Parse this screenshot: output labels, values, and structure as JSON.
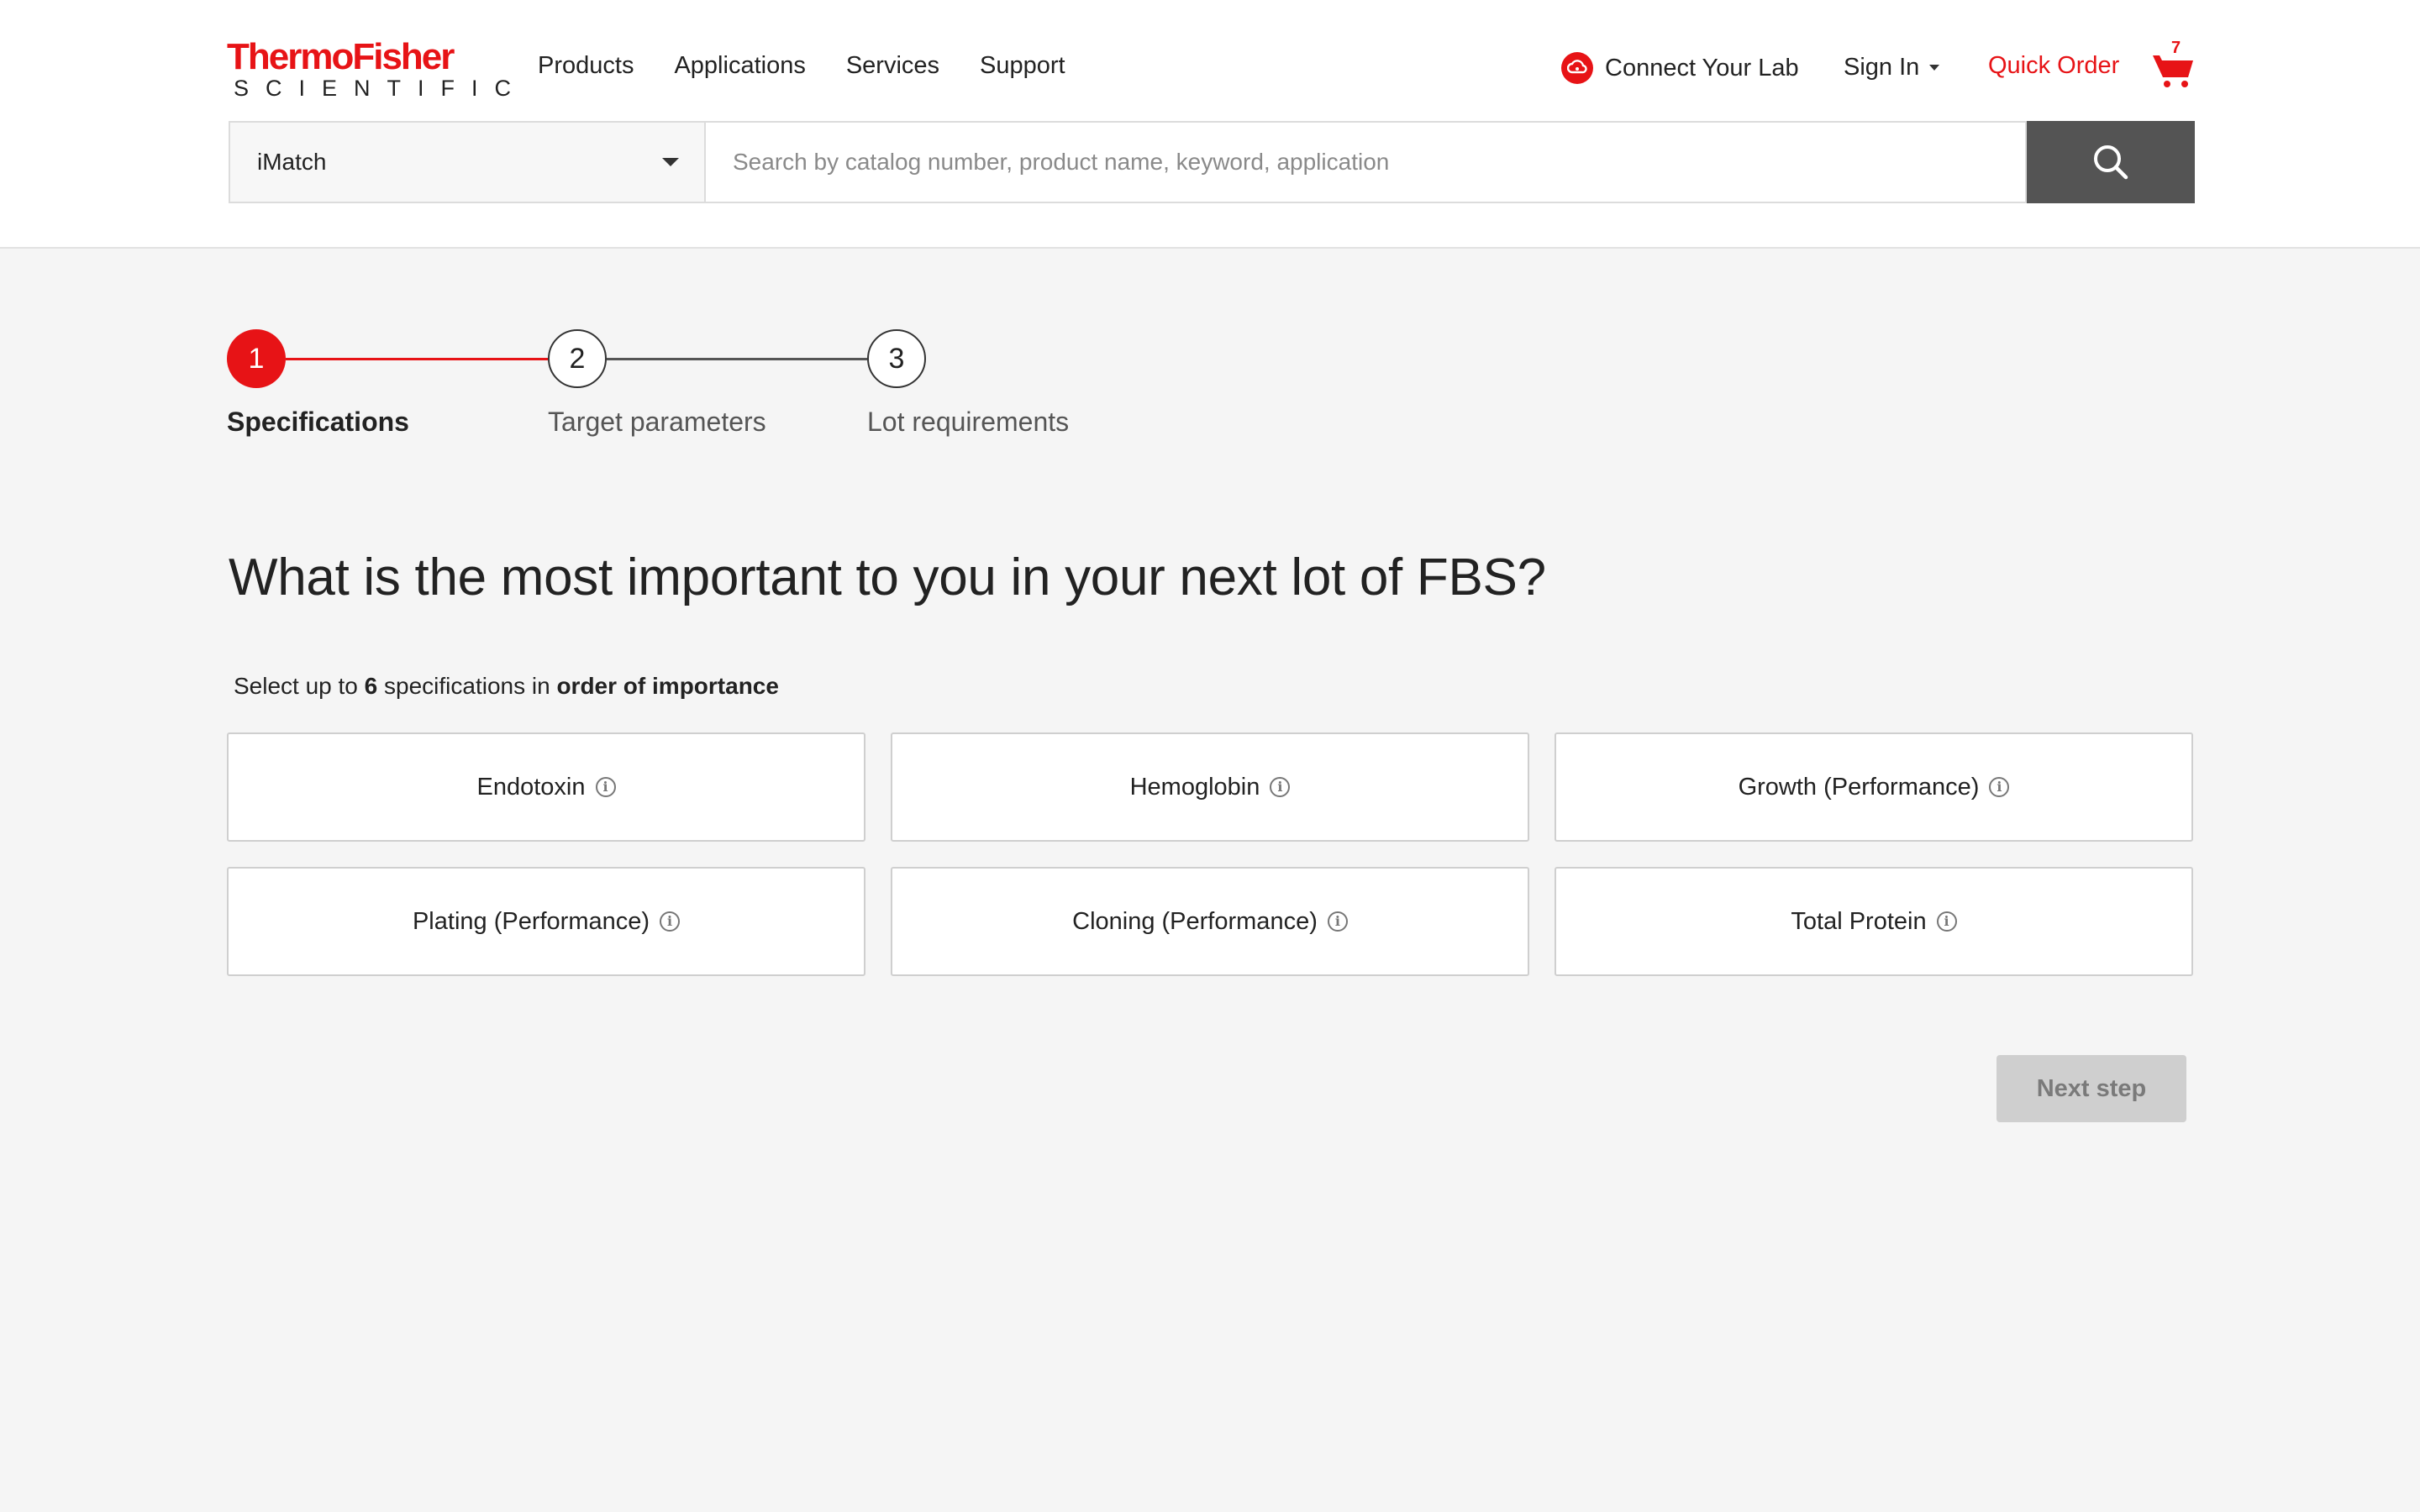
{
  "header": {
    "logo": {
      "line1": "ThermoFisher",
      "line2": "SCIENTIFIC"
    },
    "nav": [
      "Products",
      "Applications",
      "Services",
      "Support"
    ],
    "connect_lab": "Connect Your Lab",
    "sign_in": "Sign In",
    "quick_order": "Quick Order",
    "cart_count": "7"
  },
  "search": {
    "selected": "iMatch",
    "placeholder": "Search by catalog number, product name, keyword, application"
  },
  "stepper": {
    "current_step": 1,
    "steps": [
      {
        "number": "1",
        "label": "Specifications",
        "state": "active"
      },
      {
        "number": "2",
        "label": "Target parameters",
        "state": "inactive"
      },
      {
        "number": "3",
        "label": "Lot requirements",
        "state": "inactive"
      }
    ]
  },
  "main": {
    "question": "What is the most important to you in your next lot of FBS?",
    "instruction": {
      "prefix": "Select up to",
      "count": "6",
      "middle": "specifications in",
      "emphasis": "order of importance"
    },
    "options": [
      "Endotoxin",
      "Hemoglobin",
      "Growth (Performance)",
      "Plating (Performance)",
      "Cloning (Performance)",
      "Total Protein"
    ],
    "next_button": "Next step",
    "next_button_enabled": false
  },
  "colors": {
    "brand_red": "#e71316",
    "search_button": "#545454",
    "disabled_button": "#cfcfcf",
    "page_background": "#f5f5f5"
  },
  "icons": [
    "search-icon",
    "cart-icon",
    "connect-lab-icon",
    "info-icon",
    "chevron-down-icon"
  ]
}
